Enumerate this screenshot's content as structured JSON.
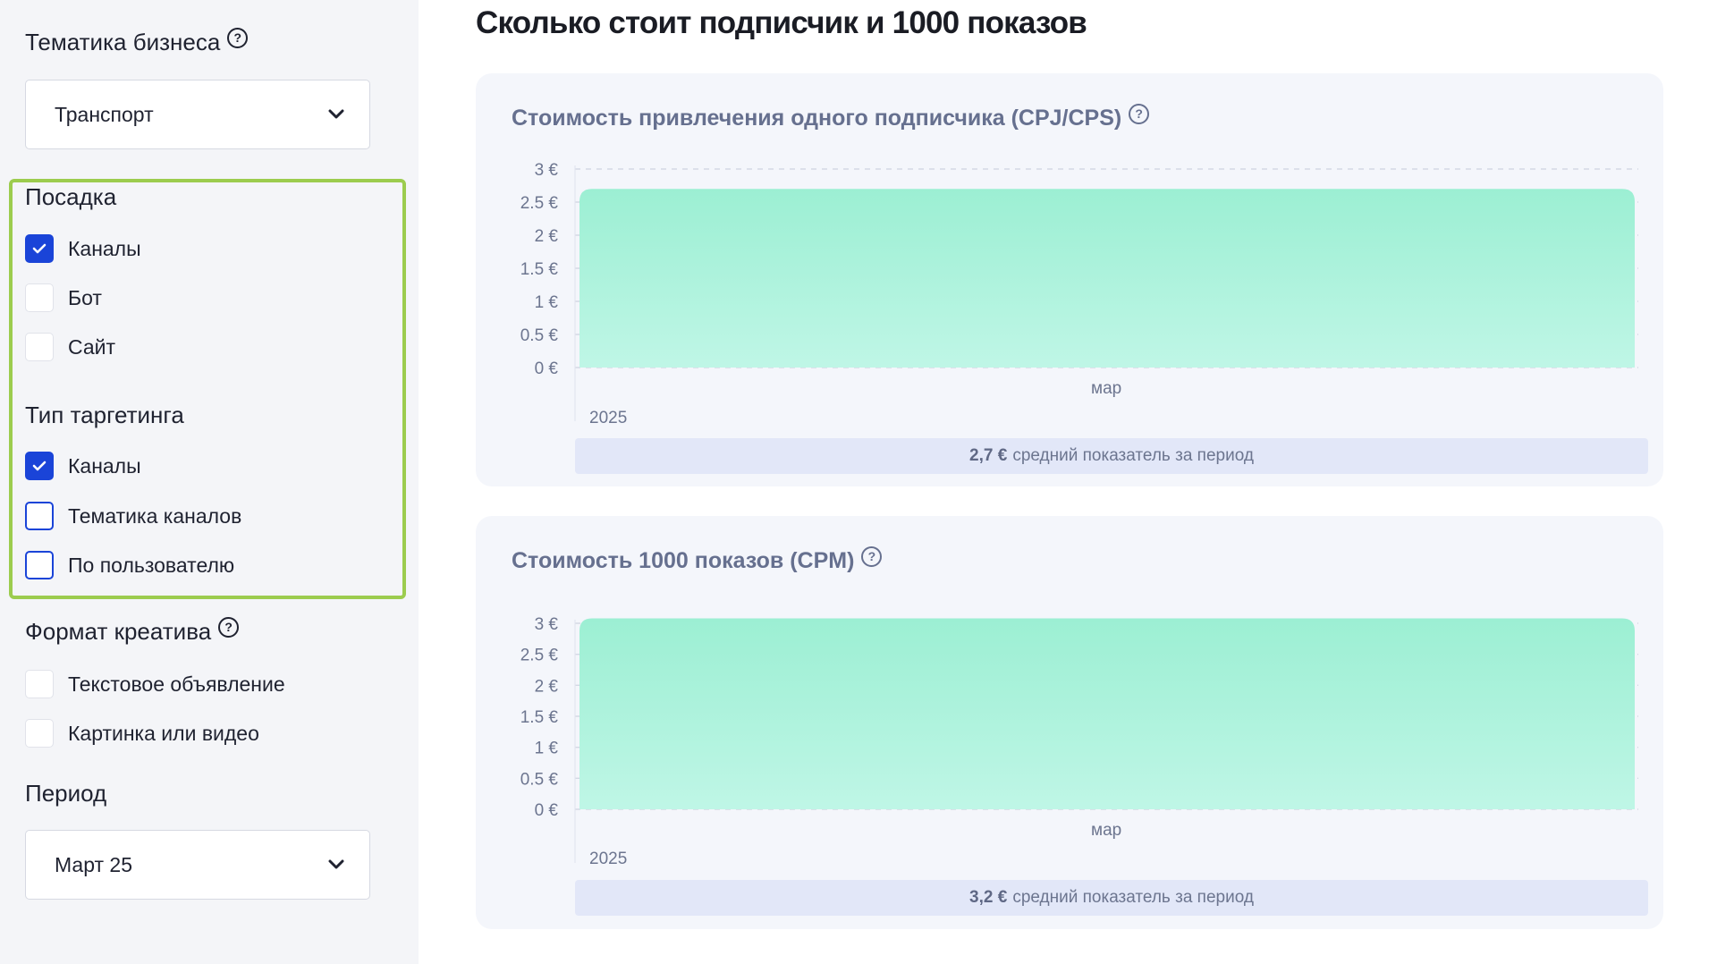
{
  "sidebar": {
    "business_topic": {
      "title": "Тематика бизнеса",
      "value": "Транспорт"
    },
    "landing": {
      "title": "Посадка",
      "items": [
        {
          "label": "Каналы",
          "checked": true
        },
        {
          "label": "Бот",
          "checked": false
        },
        {
          "label": "Сайт",
          "checked": false
        }
      ]
    },
    "targeting": {
      "title": "Тип таргетинга",
      "items": [
        {
          "label": "Каналы",
          "checked": true
        },
        {
          "label": "Тематика каналов",
          "checked": false
        },
        {
          "label": "По пользователю",
          "checked": false
        }
      ]
    },
    "creative": {
      "title": "Формат креатива",
      "items": [
        {
          "label": "Текстовое объявление",
          "checked": false
        },
        {
          "label": "Картинка или видео",
          "checked": false
        }
      ]
    },
    "period": {
      "title": "Период",
      "value": "Март 25"
    }
  },
  "main": {
    "title": "Сколько стоит подписчик и 1000 показов"
  },
  "colors": {
    "accent": "#1a44d8",
    "highlight_border": "#9ccc4e",
    "area_top": "#9cefd3",
    "area_bottom": "#bff6e6"
  },
  "chart_data": [
    {
      "type": "area",
      "title": "Стоимость привлечения одного подписчика (CPJ/CPS)",
      "x": [
        "мар"
      ],
      "year": "2025",
      "series": [
        {
          "values": [
            2.7
          ]
        }
      ],
      "ylim": [
        0,
        3
      ],
      "yticks": [
        "3 €",
        "2.5 €",
        "2 €",
        "1.5 €",
        "1 €",
        "0.5 €",
        "0 €"
      ],
      "grid": true,
      "average_value": "2,7 €",
      "average_text": "средний показатель за период"
    },
    {
      "type": "area",
      "title": "Стоимость 1000 показов (CPM)",
      "x": [
        "мар"
      ],
      "year": "2025",
      "series": [
        {
          "values": [
            3.2
          ]
        }
      ],
      "ylim": [
        0,
        3
      ],
      "yticks": [
        "3 €",
        "2.5 €",
        "2 €",
        "1.5 €",
        "1 €",
        "0.5 €",
        "0 €"
      ],
      "grid": true,
      "average_value": "3,2 €",
      "average_text": "средний показатель за период"
    }
  ]
}
